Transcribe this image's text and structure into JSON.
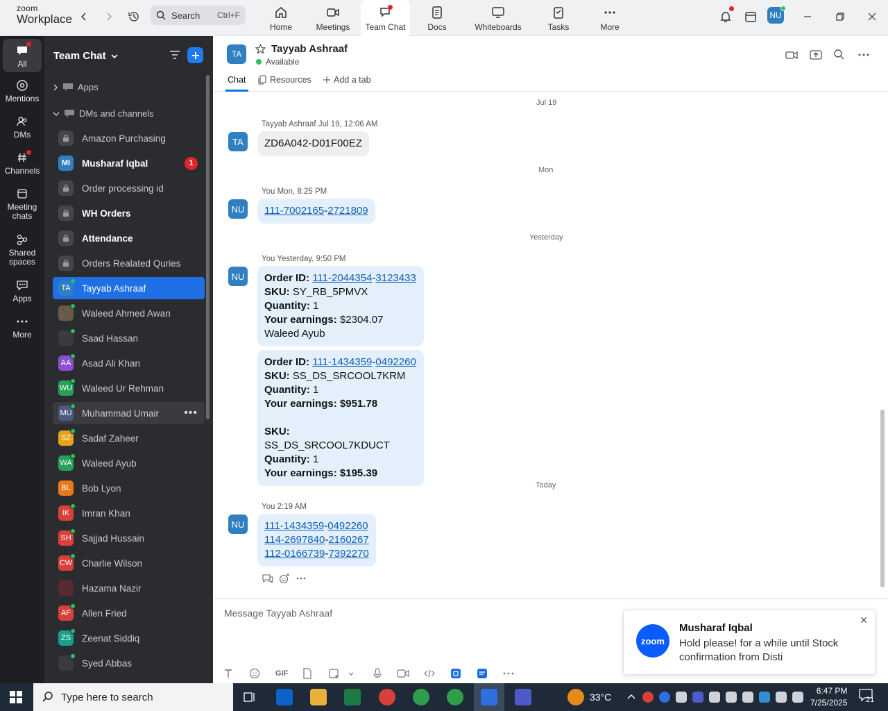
{
  "app": {
    "logo_top": "zoom",
    "logo_bottom": "Workplace"
  },
  "top": {
    "search_label": "Search",
    "search_shortcut": "Ctrl+F",
    "tabs": [
      {
        "label": "Home",
        "icon": "home-icon"
      },
      {
        "label": "Meetings",
        "icon": "video-icon"
      },
      {
        "label": "Team Chat",
        "icon": "chat-icon"
      },
      {
        "label": "Docs",
        "icon": "doc-icon"
      },
      {
        "label": "Whiteboards",
        "icon": "whiteboard-icon"
      },
      {
        "label": "Tasks",
        "icon": "tasks-icon"
      },
      {
        "label": "More",
        "icon": "more-icon"
      }
    ],
    "user_initials": "NU"
  },
  "rail": [
    {
      "label": "All"
    },
    {
      "label": "Mentions"
    },
    {
      "label": "DMs"
    },
    {
      "label": "Channels"
    },
    {
      "label": "Meeting chats"
    },
    {
      "label": "Shared spaces"
    },
    {
      "label": "Apps"
    },
    {
      "label": "More"
    }
  ],
  "sidebar": {
    "title": "Team Chat",
    "sections": {
      "apps": "Apps",
      "dms": "DMs and channels"
    },
    "items": [
      {
        "label": "Amazon Purchasing",
        "initials": ""
      },
      {
        "label": "Musharaf Iqbal",
        "initials": "MI",
        "badge": "1"
      },
      {
        "label": "Order processing id",
        "initials": ""
      },
      {
        "label": "WH Orders",
        "initials": ""
      },
      {
        "label": "Attendance",
        "initials": ""
      },
      {
        "label": "Orders Realated Quries",
        "initials": ""
      },
      {
        "label": "Tayyab Ashraaf",
        "initials": "TA"
      },
      {
        "label": "Waleed Ahmed Awan",
        "initials": ""
      },
      {
        "label": "Saad Hassan",
        "initials": ""
      },
      {
        "label": "Asad Ali Khan",
        "initials": "AA"
      },
      {
        "label": "Waleed Ur Rehman",
        "initials": "WU"
      },
      {
        "label": "Muhammad Umair",
        "initials": "MU"
      },
      {
        "label": "Sadaf Zaheer",
        "initials": "SZ"
      },
      {
        "label": "Waleed Ayub",
        "initials": "WA"
      },
      {
        "label": "Bob Lyon",
        "initials": "BL"
      },
      {
        "label": "Imran Khan",
        "initials": "IK"
      },
      {
        "label": "Sajjad Hussain",
        "initials": "SH"
      },
      {
        "label": "Charlie Wilson",
        "initials": "CW"
      },
      {
        "label": "Hazama Nazir",
        "initials": ""
      },
      {
        "label": "Allen Fried",
        "initials": "AF"
      },
      {
        "label": "Zeenat Siddiq",
        "initials": "ZS"
      },
      {
        "label": "Syed Abbas",
        "initials": ""
      }
    ]
  },
  "chat": {
    "contact_initials": "TA",
    "contact_name": "Tayyab Ashraaf",
    "status": "Available",
    "tabs": {
      "chat": "Chat",
      "resources": "Resources",
      "add": "Add a tab"
    },
    "dates": [
      "Jul 19",
      "Mon",
      "Yesterday",
      "Today"
    ],
    "messages": [
      {
        "avatar": "TA",
        "meta": "Tayyab Ashraaf Jul 19, 12:06 AM",
        "text": "ZD6A042-D01F00EZ"
      },
      {
        "avatar": "NU",
        "meta": "You Mon, 8:25 PM",
        "link_a": "111-7002165",
        "link_b": "2721809"
      },
      {
        "avatar": "NU",
        "meta": "You Yesterday, 9:50 PM"
      },
      {
        "avatar": "NU",
        "meta": "You 2:19 AM"
      }
    ],
    "order1": {
      "label_order": "Order ID:",
      "order_a": "111-2044354",
      "order_b": "3123433",
      "label_sku": "SKU:",
      "sku": "SY_RB_5PMVX",
      "label_qty": "Quantity:",
      "qty": "1",
      "label_earn": "Your earnings:",
      "earn": "$2304.07",
      "note": "Waleed Ayub"
    },
    "order2": {
      "label_order": "Order ID:",
      "order_a": "111-1434359",
      "order_b": "0492260",
      "label_sku": "SKU:",
      "sku": "SS_DS_SRCOOL7KRM",
      "label_qty": "Quantity:",
      "qty": "1",
      "earn_line": "Your earnings: $951.78",
      "sku2": "SS_DS_SRCOOL7KDUCT",
      "qty2": "1",
      "earn_line2": "Your earnings: $195.39"
    },
    "last_links": [
      {
        "a": "111-1434359",
        "b": "0492260"
      },
      {
        "a": "114-2697840",
        "b": "2160267"
      },
      {
        "a": "112-0166739",
        "b": "7392270"
      }
    ],
    "composer_placeholder": "Message Tayyab Ashraaf",
    "gif_label": "GIF"
  },
  "toast": {
    "logo": "zoom",
    "title": "Musharaf Iqbal",
    "body": "Hold please! for a while until Stock confirmation from Disti"
  },
  "taskbar": {
    "search": "Type here to search",
    "temp": "33°C",
    "time": "6:47 PM",
    "date": "7/25/2025",
    "notif": "21"
  }
}
